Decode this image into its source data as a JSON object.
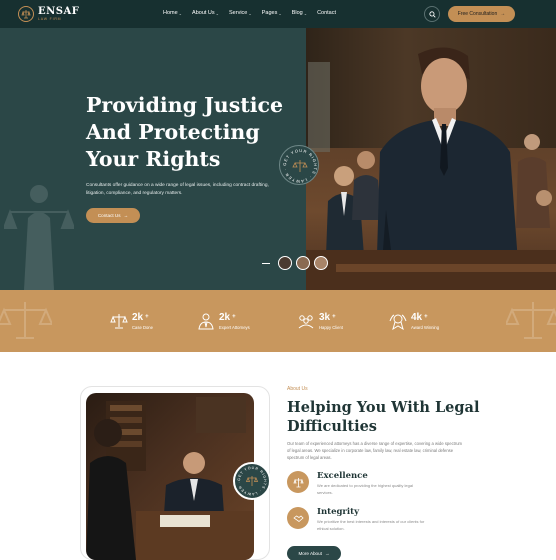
{
  "brand": {
    "name": "ENSAF",
    "tagline": "LAW FIRM"
  },
  "nav": {
    "items": [
      {
        "label": "Home",
        "has_dropdown": true
      },
      {
        "label": "About Us",
        "has_dropdown": true
      },
      {
        "label": "Service",
        "has_dropdown": true
      },
      {
        "label": "Pages",
        "has_dropdown": true
      },
      {
        "label": "Blog",
        "has_dropdown": true
      },
      {
        "label": "Contact",
        "has_dropdown": false
      }
    ],
    "search_icon": "search-icon",
    "cta_label": "Free Consultation",
    "dropdown_glyph": "⌄",
    "arrow_glyph": "→"
  },
  "hero": {
    "title_lines": [
      "Providing Justice",
      "And Protecting",
      "Your Rights"
    ],
    "description": "Consultants offer guidance on a wide range of legal issues, including contract drafting, litigation, compliance, and regulatory matters.",
    "button_label": "Contact Us",
    "badge_text": "GET YOUR RIGHTS · LAWYER · "
  },
  "stats": [
    {
      "value": "2k",
      "suffix": "+",
      "label": "Case Done",
      "icon": "justice-icon"
    },
    {
      "value": "2k",
      "suffix": "+",
      "label": "Expert Attorneys",
      "icon": "attorney-icon"
    },
    {
      "value": "3k",
      "suffix": "+",
      "label": "Happy Client",
      "icon": "clients-icon"
    },
    {
      "value": "4k",
      "suffix": "+",
      "label": "Award Winning",
      "icon": "award-icon"
    }
  ],
  "about": {
    "tag": "About Us",
    "title_lines": [
      "Helping You With Legal",
      "Difficulties"
    ],
    "description": "Our team of experienced attorneys has a diverse range of expertise, covering a wide spectrum of legal areas. We specialize in corporate law, family law, real estate law, criminal defense spectrum of legal areas.",
    "features": [
      {
        "title": "Excellence",
        "description": "We are dedicated to providing the highest quality legal services.",
        "icon": "scales-icon"
      },
      {
        "title": "Integrity",
        "description": "We prioritize the best interests and interests of our clients for ethical solution.",
        "icon": "handshake-icon"
      }
    ],
    "button_label": "More About",
    "badge_text": "GET YOUR RIGHTS · LAWYER · "
  },
  "colors": {
    "dark_teal": "#2b4747",
    "nav_bg": "#173030",
    "gold": "#c38f55",
    "stats_bg": "#c8975e"
  }
}
